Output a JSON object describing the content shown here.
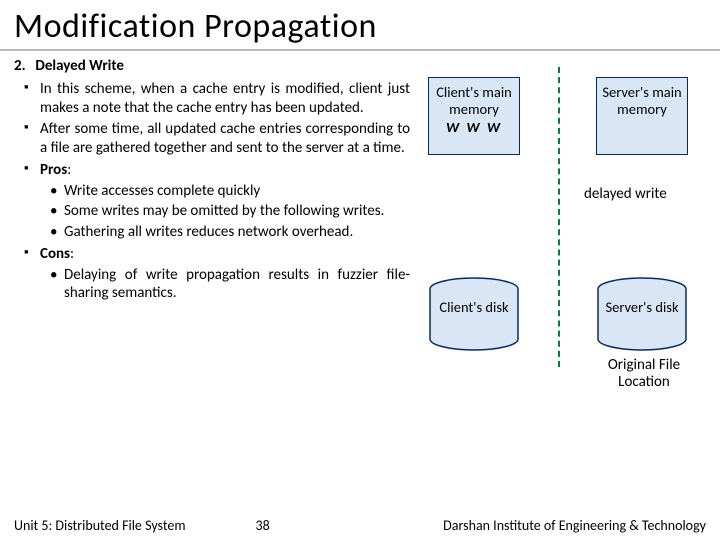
{
  "title": "Modification Propagation",
  "section": {
    "number": "2.",
    "heading": "Delayed Write",
    "bullets": [
      "In this scheme, when a cache entry is modified, client just makes a note that the cache entry has been updated.",
      "After some time, all updated cache entries corresponding to a file are gathered together and sent to the server at a time."
    ],
    "pros_label": "Pros",
    "pros": [
      "Write accesses complete quickly",
      "Some writes may be omitted by the following writes.",
      "Gathering all writes reduces network overhead."
    ],
    "cons_label": "Cons",
    "cons": [
      "Delaying of write propagation results in fuzzier file-sharing semantics."
    ]
  },
  "diagram": {
    "client_mem": "Client's main memory",
    "client_mem_w": "W W W",
    "server_mem": "Server's main memory",
    "client_disk": "Client's disk",
    "server_disk": "Server's disk",
    "delayed": "delayed write",
    "original": "Original File Location"
  },
  "footer": {
    "unit": "Unit 5: Distributed File System",
    "page": "38",
    "institute": "Darshan Institute of Engineering & Technology"
  }
}
